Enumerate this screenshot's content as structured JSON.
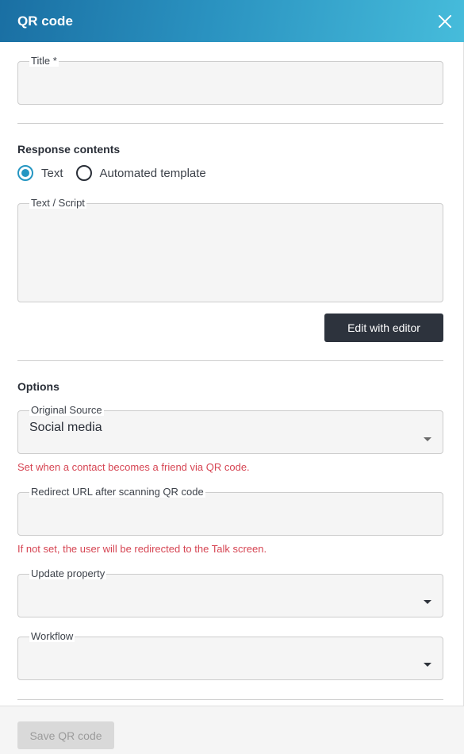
{
  "header": {
    "title": "QR code",
    "close_icon": "close-icon"
  },
  "form": {
    "title_field": {
      "label": "Title *",
      "value": ""
    },
    "response_contents": {
      "heading": "Response contents",
      "options": [
        {
          "label": "Text",
          "checked": true
        },
        {
          "label": "Automated template",
          "checked": false
        }
      ],
      "text_script": {
        "label": "Text / Script",
        "value": ""
      },
      "edit_button": "Edit with editor"
    },
    "options": {
      "heading": "Options",
      "original_source": {
        "label": "Original Source",
        "value": "Social media",
        "hint": "Set when a contact becomes a friend via QR code."
      },
      "redirect_url": {
        "label": "Redirect URL after scanning QR code",
        "value": "",
        "hint": "If not set, the user will be redirected to the Talk screen."
      },
      "update_property": {
        "label": "Update property",
        "value": ""
      },
      "workflow": {
        "label": "Workflow",
        "value": ""
      }
    }
  },
  "footer": {
    "save_button": "Save QR code"
  },
  "colors": {
    "accent": "#2596c2",
    "hint": "#d64553",
    "dark_button": "#2d333d"
  }
}
